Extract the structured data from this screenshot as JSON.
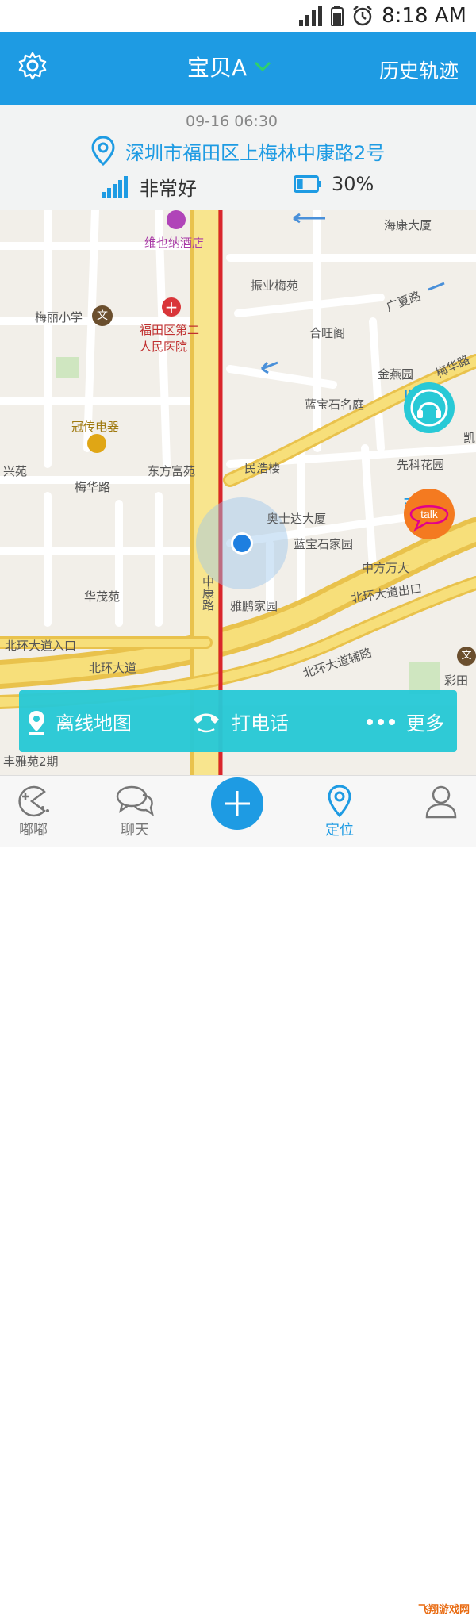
{
  "status": {
    "time": "8:18 AM"
  },
  "header": {
    "title": "宝贝A",
    "history_label": "历史轨迹"
  },
  "info": {
    "timestamp": "09-16 06:30",
    "address": "深圳市福田区上梅林中康路2号",
    "signal_text": "非常好",
    "battery_text": "30%",
    "battery_level": 0.3
  },
  "map": {
    "labels": {
      "hotel": "维也纳酒店",
      "haikang": "海康大厦",
      "zhenye": "振业梅苑",
      "meili_school": "梅丽小学",
      "hospital": "福田区第二人民医院",
      "heyuange": "合旺阁",
      "guangxia_road": "广夏路",
      "jinyanyuan": "金燕园",
      "meihua_road_ne": "梅华路",
      "lanbaoshi": "蓝宝石名庭",
      "guanchuan": "冠传电器",
      "xingyuan": "兴苑",
      "dongfangfuyuan": "东方富苑",
      "minhaolou": "民浩楼",
      "xiankehuayuan": "先科花园",
      "meihua_road": "梅华路",
      "aoshida": "奥士达大厦",
      "lanbaoshijia": "蓝宝石家园",
      "zhongkang_road": "中康路",
      "huaguiyuan": "华茂苑",
      "yajingjiayuan": "雅鹏家园",
      "beihuan_exit": "北环大道出口",
      "beihuan_entry": "北环大道入口",
      "beihuan": "北环大道",
      "beihuan_aux": "北环大道辅路",
      "caitian": "彩田",
      "zhongfang": "中方万大",
      "fengyayuan": "丰雅苑2期",
      "kaiyuan": "凯",
      "zhongkangroad_v": "中康路"
    }
  },
  "side_buttons": {
    "monitor_label": "监听",
    "talk_label": "对讲",
    "talk_icon_text": "talk"
  },
  "actions": {
    "offline_map": "离线地图",
    "call": "打电话",
    "more": "更多"
  },
  "tabs": {
    "dudu": "嘟嘟",
    "chat": "聊天",
    "locate": "定位"
  },
  "watermark": "飞翔游戏网"
}
